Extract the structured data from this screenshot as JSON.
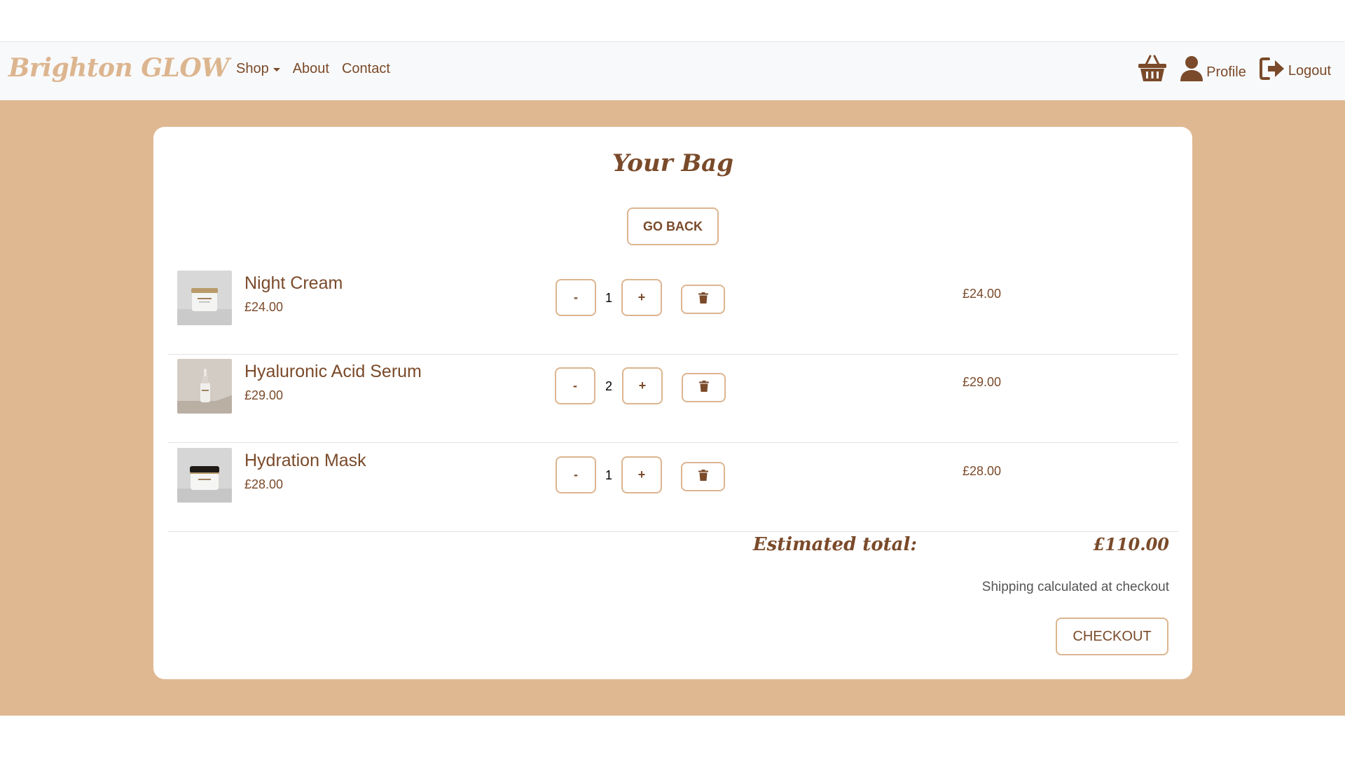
{
  "nav": {
    "brand": "Brighton GLOW",
    "links": [
      "Shop",
      "About",
      "Contact"
    ],
    "profile_label": "Profile",
    "logout_label": "Logout"
  },
  "bag": {
    "title": "Your Bag",
    "go_back": "GO BACK",
    "items": [
      {
        "name": "Night Cream",
        "unit_price": "£24.00",
        "quantity": "1",
        "line_total": "£24.00"
      },
      {
        "name": "Hyaluronic Acid Serum",
        "unit_price": "£29.00",
        "quantity": "2",
        "line_total": "£29.00"
      },
      {
        "name": "Hydration Mask",
        "unit_price": "£28.00",
        "quantity": "1",
        "line_total": "£28.00"
      }
    ],
    "minus": "-",
    "plus": "+",
    "estimated_label": "Estimated total:",
    "estimated_value": "£110.00",
    "shipping_note": "Shipping calculated at checkout",
    "checkout": "CHECKOUT"
  },
  "colors": {
    "brand": "#dcb58f",
    "text_brown": "#7a4a2a",
    "band": "#dfb892",
    "navbar_bg": "#f8f9fa"
  },
  "icons": [
    "basket-icon",
    "user-icon",
    "logout-icon",
    "trash-icon",
    "caret-down-icon"
  ]
}
